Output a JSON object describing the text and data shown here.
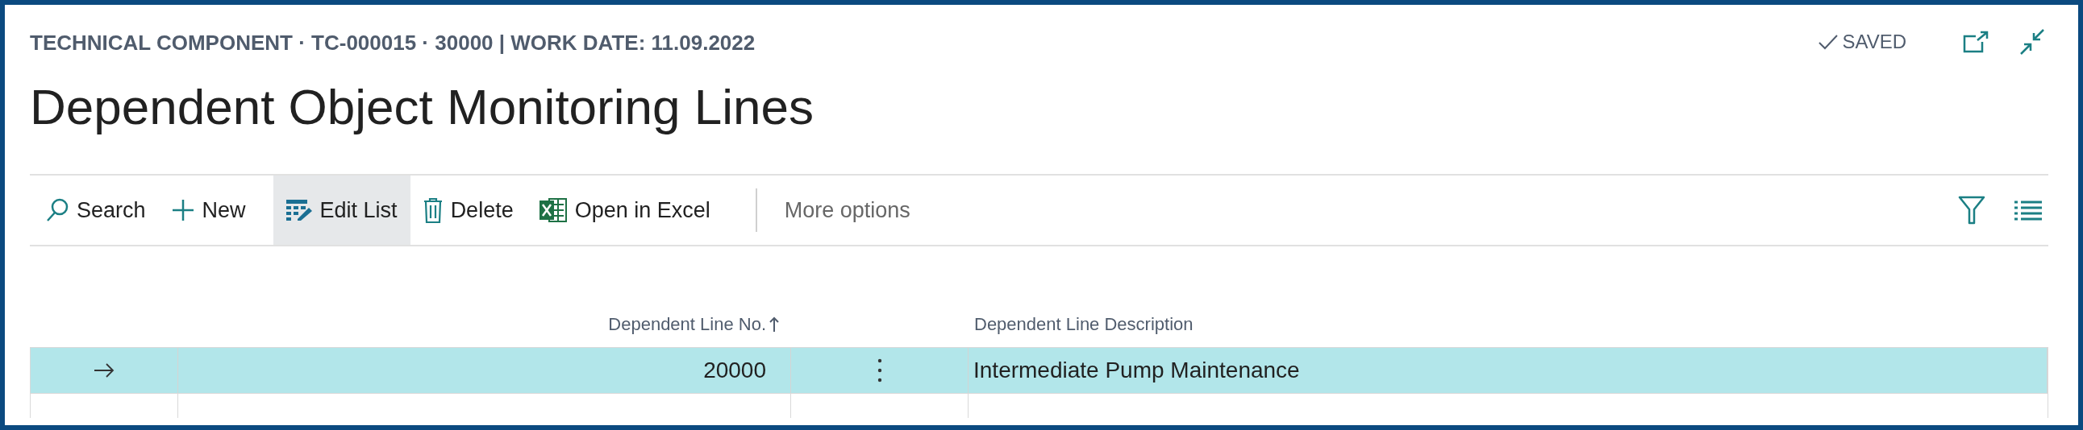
{
  "header": {
    "caption": "TECHNICAL COMPONENT · TC-000015 · 30000 | WORK DATE: 11.09.2022",
    "status": "SAVED"
  },
  "title": "Dependent Object Monitoring Lines",
  "actions": [
    {
      "kind": "search",
      "label": "Search",
      "selected": false
    },
    {
      "kind": "new",
      "label": "New",
      "selected": false
    },
    {
      "kind": "edit_list",
      "label": "Edit List",
      "selected": true
    },
    {
      "kind": "delete",
      "label": "Delete",
      "selected": false
    },
    {
      "kind": "excel",
      "label": "Open in Excel",
      "selected": false
    }
  ],
  "more_options": "More options",
  "table": {
    "columns": [
      {
        "label": "Dependent Line No.",
        "sort_ascending": true
      },
      {
        "label": "Dependent Line Description"
      }
    ],
    "rows": [
      {
        "line_no": "20000",
        "description": "Intermediate Pump Maintenance",
        "selected": true
      }
    ]
  }
}
